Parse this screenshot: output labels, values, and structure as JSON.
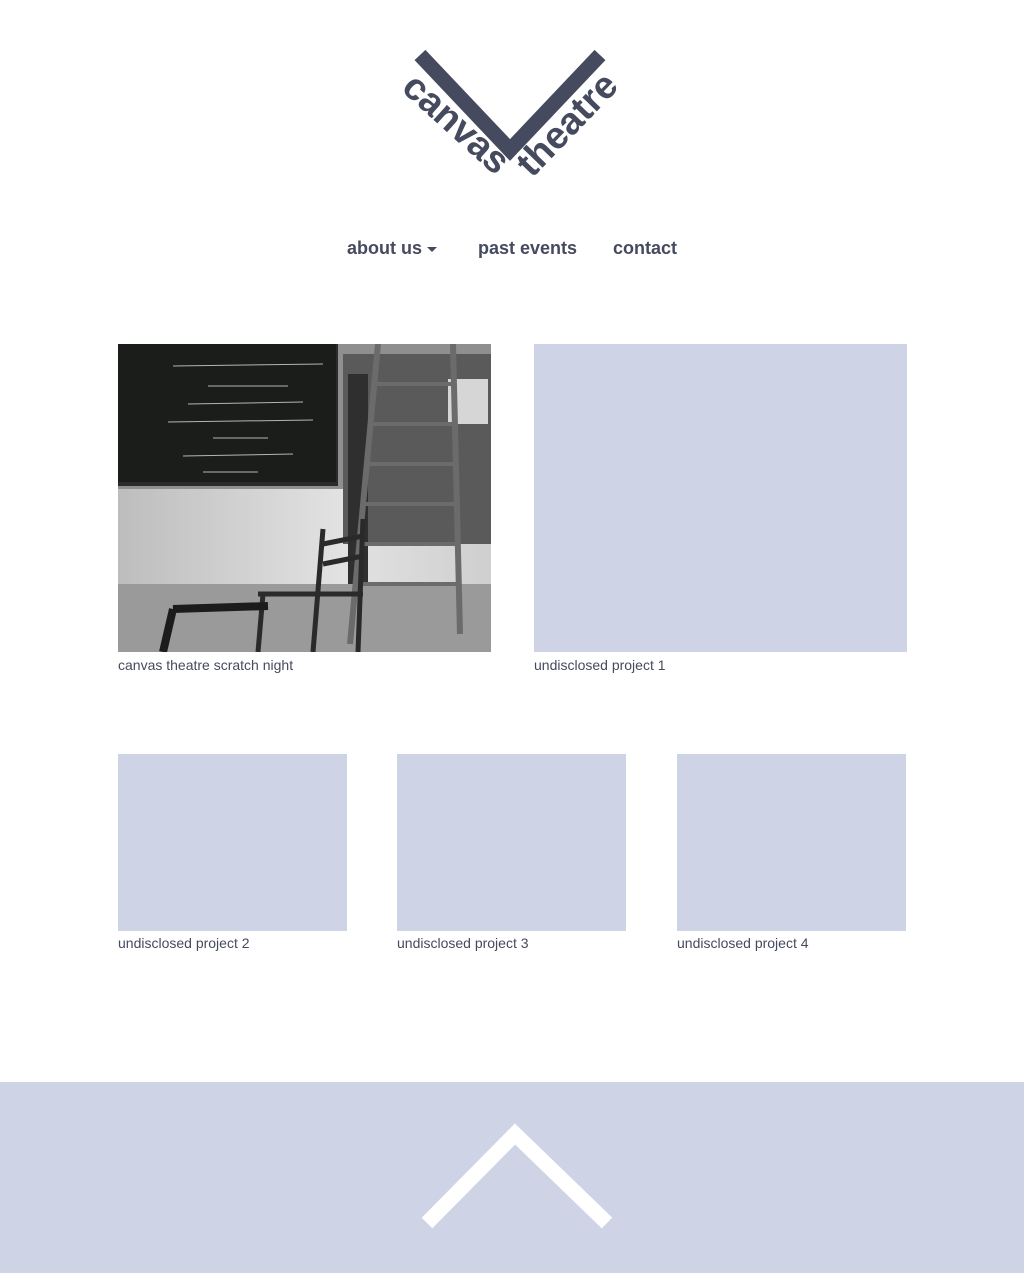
{
  "brand": {
    "logo_word_left": "canvas",
    "logo_word_right": "theatre",
    "primary_color": "#464a5e",
    "placeholder_color": "#ced3e6"
  },
  "nav": {
    "items": [
      {
        "label": "about us",
        "has_dropdown": true,
        "icon": "caret-down-icon"
      },
      {
        "label": "past events"
      },
      {
        "label": "contact"
      }
    ]
  },
  "projects": [
    {
      "caption": "canvas theatre scratch night",
      "has_photo": true
    },
    {
      "caption": "undisclosed project 1"
    },
    {
      "caption": "undisclosed project 2"
    },
    {
      "caption": "undisclosed project 3"
    },
    {
      "caption": "undisclosed project 4"
    }
  ],
  "footer": {
    "icon": "chevron-up-icon",
    "background": "#ced3e6"
  }
}
